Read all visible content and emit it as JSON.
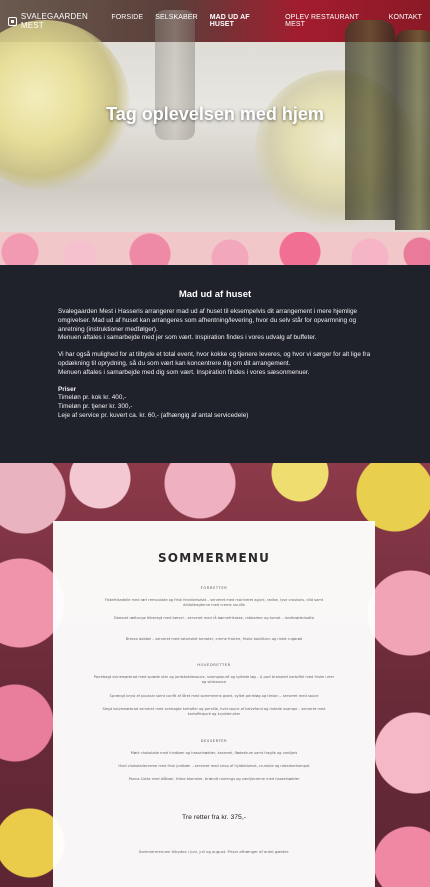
{
  "brand": {
    "logo_text": "SVALEGAARDEN MEST"
  },
  "nav": {
    "items": [
      {
        "label": "FORSIDE"
      },
      {
        "label": "SELSKABER"
      },
      {
        "label": "MAD UD AF HUSET"
      },
      {
        "label": "OPLEV RESTAURANT MEST"
      },
      {
        "label": "KONTAKT"
      }
    ],
    "active_index": 2
  },
  "hero": {
    "title": "Tag oplevelsen med hjem"
  },
  "info": {
    "title": "Mad ud af huset",
    "p1": "Svalegaarden Mest i Hasseris arrangerer mad ud af huset til eksempelvis dit arrangement i mere hjemlige omgivelser. Mad ud af huset kan arrangeres som afhentning/levering, hvor du selv står for opvarmning og anretning (instruktioner medfølger).",
    "p1b": "Menuen aftales i samarbejde med jer som vært. Inspiration findes i vores udvalg af buffeter.",
    "p2": "Vi har også mulighed for at tilbyde et total event, hvor kokke og tjenere leveres, og hvor vi sørger for alt lige fra opdækning til oprydning, så du som vært kan koncentrere dig om dit arrangement.",
    "p2b": "Menuen aftales i samarbejde med dig som vært. Inspiration findes i vores sæsonmenuer.",
    "prices_heading": "Priser",
    "price_1": "Timeløn pr. kok kr. 400,-",
    "price_2": "Timeløn pr. tjener kr. 300,-",
    "price_3": "Leje af service pr. kuvert ca. kr. 60,- (afhængig af antal servicedele)"
  },
  "menu": {
    "title": "SOMMERMENU",
    "forret_heading": "FORRETTER",
    "forret": [
      "Fiskefrikadelle med rørt remoulade og frisk fennikelsalat – serveret med marineret agurk, radise, lyse croutons, dild samt dildolieagterne med creme nouille",
      "Dampet rødtunge tilberegt med kørvel – serveret med rå bønnefrikasse, rabbarber og tomat – landbrødsrisotto",
      "Bresco dobbel – serveret med tatarisket tomater, creme fraiche, friske basilikum og ristet rugbrød"
    ],
    "hoved_heading": "HOVEDRETTER",
    "hoved": [
      "Porrebagt svinemørbrad med sprøde skin og jordskokkesauce, svampepuré og syltede løg – A part braiseret kartoffel med friske urter og sildesauce",
      "Sprængt bryst af poussin samt confit af låret med sommerens grønt, syltet perleløg og timian – serveret med sauce",
      "Stegt kalvemørbrad serveret med ovnbagte kartofler og persille, hvid sauce af kalvefond og ristede svampe – serveret med kartoffelpuré og krydderurter"
    ],
    "dessert_heading": "DESSERTER",
    "dessert": [
      "Mørk chokolade med hindbær og hasselnødder, karamel, flødeskum samt fragile og vaniljeis",
      "Hvid chokoladecreme med frisk jordbær – serveret med sirup af hyldeblomst, crumble og rabarberkompot",
      "Panna Cotta med blåbær, friske blomster, brændt marengs og vaniljecreme med hasselnødder"
    ],
    "price": "Tre retter fra kr. 375,-",
    "note": "Sommermenuen tilbydes i juni, juli og august. Priser afhænger af antal gæster."
  }
}
